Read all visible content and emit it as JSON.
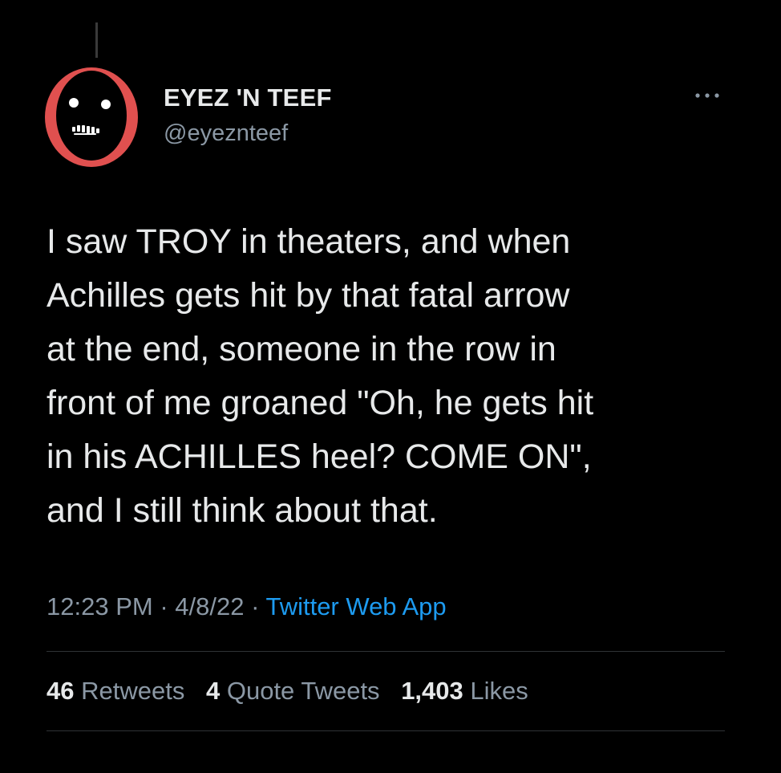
{
  "author": {
    "name": "EYEZ 'N TEEF",
    "handle": "@eyeznteef",
    "avatar_icon": "skull-face-avatar-icon"
  },
  "more_icon": "more-dots-icon",
  "tweet": {
    "lines": [
      "I saw TROY in theaters, and when",
      "Achilles gets hit by that fatal arrow",
      "at the end, someone in the row in",
      "front of me groaned \"Oh, he gets hit",
      "in his ACHILLES heel? COME ON\",",
      "and I still think about that."
    ]
  },
  "meta": {
    "time": "12:23 PM",
    "sep1": " · ",
    "date": "4/8/22",
    "sep2": " · ",
    "source": "Twitter Web App"
  },
  "stats": {
    "retweets_count": "46",
    "retweets_label": "Retweets",
    "quotes_count": "4",
    "quotes_label": "Quote Tweets",
    "likes_count": "1,403",
    "likes_label": "Likes"
  },
  "colors": {
    "background": "#000000",
    "text": "#e7e9ea",
    "secondary": "#8b98a5",
    "link": "#1d9bf0",
    "avatar_accent": "#e0504f"
  }
}
